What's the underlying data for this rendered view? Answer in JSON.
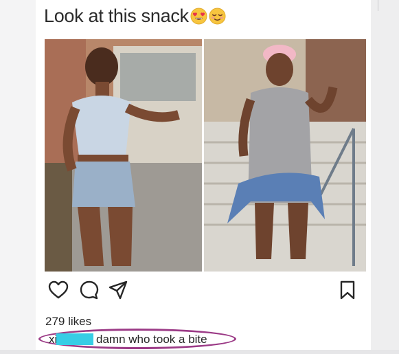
{
  "post": {
    "caption": "Look at this snack",
    "caption_emojis": [
      "heart-eyes-emoji",
      "relieved-smile-emoji"
    ],
    "likes": "279 likes",
    "comment": {
      "username_visible": "xi",
      "text": "damn who took a bite"
    }
  },
  "colors": {
    "highlight_oval": "#9b3a86",
    "redaction": "#37cde5",
    "text": "#262626"
  },
  "icons": [
    "heart-icon",
    "comment-icon",
    "share-icon",
    "bookmark-icon"
  ]
}
